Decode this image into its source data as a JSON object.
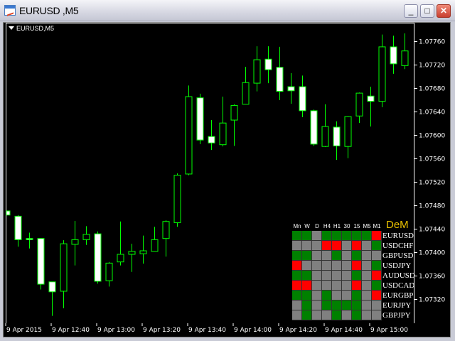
{
  "window": {
    "title": "EURUSD ,M5",
    "minimize": "_",
    "maximize": "□",
    "close": "✕"
  },
  "chart": {
    "symbol_label": "EURUSD,M5",
    "bull_color": "#000000",
    "bear_color": "#ffffff",
    "line_color": "#00ff00",
    "price_min": 1.073,
    "price_max": 1.07776,
    "price_labels": [
      "1.07760",
      "1.07720",
      "1.07680",
      "1.07640",
      "1.07600",
      "1.07560",
      "1.07520",
      "1.07480",
      "1.07440",
      "1.07400",
      "1.07360",
      "1.07320"
    ],
    "time_labels": [
      "9 Apr 2015",
      "9 Apr 12:40",
      "9 Apr 13:00",
      "9 Apr 13:20",
      "9 Apr 13:40",
      "9 Apr 14:00",
      "9 Apr 14:20",
      "9 Apr 14:40",
      "9 Apr 15:00"
    ],
    "candles": [
      [
        1.07471,
        1.07471,
        1.07464,
        1.07464
      ],
      [
        1.07462,
        1.07464,
        1.0741,
        1.07422
      ],
      [
        1.07424,
        1.07434,
        1.07407,
        1.07422
      ],
      [
        1.07424,
        1.07424,
        1.07337,
        1.07346
      ],
      [
        1.0735,
        1.0735,
        1.07292,
        1.07333
      ],
      [
        1.07334,
        1.07421,
        1.07305,
        1.07415
      ],
      [
        1.07414,
        1.07454,
        1.07378,
        1.07422
      ],
      [
        1.07422,
        1.07445,
        1.07413,
        1.07431
      ],
      [
        1.07432,
        1.07436,
        1.07347,
        1.07351
      ],
      [
        1.07352,
        1.07384,
        1.07342,
        1.07382
      ],
      [
        1.07384,
        1.07453,
        1.07378,
        1.07397
      ],
      [
        1.07397,
        1.07415,
        1.07367,
        1.07402
      ],
      [
        1.07398,
        1.07429,
        1.07381,
        1.07403
      ],
      [
        1.07402,
        1.07444,
        1.07402,
        1.07422
      ],
      [
        1.07424,
        1.07455,
        1.07393,
        1.07453
      ],
      [
        1.07451,
        1.07535,
        1.07444,
        1.07532
      ],
      [
        1.07534,
        1.07685,
        1.07532,
        1.07666
      ],
      [
        1.07664,
        1.07671,
        1.07585,
        1.07592
      ],
      [
        1.07598,
        1.07626,
        1.07575,
        1.07587
      ],
      [
        1.07584,
        1.07666,
        1.07581,
        1.07621
      ],
      [
        1.07626,
        1.07653,
        1.07582,
        1.07651
      ],
      [
        1.07653,
        1.07717,
        1.07653,
        1.0769
      ],
      [
        1.07689,
        1.07752,
        1.07675,
        1.07729
      ],
      [
        1.0773,
        1.07752,
        1.07689,
        1.07712
      ],
      [
        1.07716,
        1.07751,
        1.0766,
        1.07675
      ],
      [
        1.07683,
        1.07706,
        1.07654,
        1.07676
      ],
      [
        1.07683,
        1.07702,
        1.07631,
        1.07642
      ],
      [
        1.07642,
        1.07644,
        1.07582,
        1.07585
      ],
      [
        1.07581,
        1.07653,
        1.0758,
        1.07615
      ],
      [
        1.07614,
        1.07624,
        1.07558,
        1.07582
      ],
      [
        1.07581,
        1.07633,
        1.07561,
        1.07632
      ],
      [
        1.07633,
        1.07673,
        1.07621,
        1.07672
      ],
      [
        1.07667,
        1.07683,
        1.07615,
        1.07658
      ],
      [
        1.07658,
        1.07772,
        1.07648,
        1.07751
      ],
      [
        1.07751,
        1.0777,
        1.07705,
        1.07722
      ],
      [
        1.07719,
        1.07774,
        1.07713,
        1.07744
      ]
    ]
  },
  "dem": {
    "title": "DeM",
    "columns": [
      "Mn",
      "W",
      "D",
      "H4",
      "H1",
      "30",
      "15",
      "M5",
      "M1"
    ],
    "colors": {
      "G": "#008000",
      "S": "#808080",
      "R": "#ff0000"
    },
    "rows": [
      {
        "pair": "EURUSD",
        "cells": "GGSGGGGGR"
      },
      {
        "pair": "USDCHF",
        "cells": "SSSRRSRSG"
      },
      {
        "pair": "GBPUSD",
        "cells": "GGSSGSGSS"
      },
      {
        "pair": "USDJPY",
        "cells": "RSSSSSRSG"
      },
      {
        "pair": "AUDUSD",
        "cells": "GGSSSSGSR"
      },
      {
        "pair": "USDCAD",
        "cells": "RRSSSSRSG"
      },
      {
        "pair": "EURGBP",
        "cells": "GGSGSSGSR"
      },
      {
        "pair": "EURJPY",
        "cells": "SGSGGGGSS"
      },
      {
        "pair": "GBPJPY",
        "cells": "SGSSGSGSS"
      }
    ]
  }
}
